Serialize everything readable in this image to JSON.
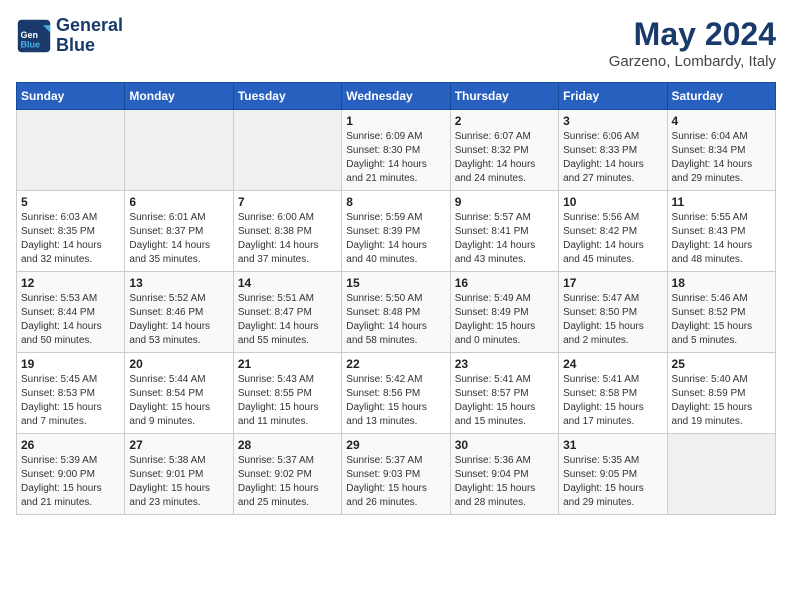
{
  "logo": {
    "line1": "General",
    "line2": "Blue"
  },
  "title": "May 2024",
  "subtitle": "Garzeno, Lombardy, Italy",
  "days_of_week": [
    "Sunday",
    "Monday",
    "Tuesday",
    "Wednesday",
    "Thursday",
    "Friday",
    "Saturday"
  ],
  "weeks": [
    [
      {
        "day": "",
        "info": ""
      },
      {
        "day": "",
        "info": ""
      },
      {
        "day": "",
        "info": ""
      },
      {
        "day": "1",
        "info": "Sunrise: 6:09 AM\nSunset: 8:30 PM\nDaylight: 14 hours\nand 21 minutes."
      },
      {
        "day": "2",
        "info": "Sunrise: 6:07 AM\nSunset: 8:32 PM\nDaylight: 14 hours\nand 24 minutes."
      },
      {
        "day": "3",
        "info": "Sunrise: 6:06 AM\nSunset: 8:33 PM\nDaylight: 14 hours\nand 27 minutes."
      },
      {
        "day": "4",
        "info": "Sunrise: 6:04 AM\nSunset: 8:34 PM\nDaylight: 14 hours\nand 29 minutes."
      }
    ],
    [
      {
        "day": "5",
        "info": "Sunrise: 6:03 AM\nSunset: 8:35 PM\nDaylight: 14 hours\nand 32 minutes."
      },
      {
        "day": "6",
        "info": "Sunrise: 6:01 AM\nSunset: 8:37 PM\nDaylight: 14 hours\nand 35 minutes."
      },
      {
        "day": "7",
        "info": "Sunrise: 6:00 AM\nSunset: 8:38 PM\nDaylight: 14 hours\nand 37 minutes."
      },
      {
        "day": "8",
        "info": "Sunrise: 5:59 AM\nSunset: 8:39 PM\nDaylight: 14 hours\nand 40 minutes."
      },
      {
        "day": "9",
        "info": "Sunrise: 5:57 AM\nSunset: 8:41 PM\nDaylight: 14 hours\nand 43 minutes."
      },
      {
        "day": "10",
        "info": "Sunrise: 5:56 AM\nSunset: 8:42 PM\nDaylight: 14 hours\nand 45 minutes."
      },
      {
        "day": "11",
        "info": "Sunrise: 5:55 AM\nSunset: 8:43 PM\nDaylight: 14 hours\nand 48 minutes."
      }
    ],
    [
      {
        "day": "12",
        "info": "Sunrise: 5:53 AM\nSunset: 8:44 PM\nDaylight: 14 hours\nand 50 minutes."
      },
      {
        "day": "13",
        "info": "Sunrise: 5:52 AM\nSunset: 8:46 PM\nDaylight: 14 hours\nand 53 minutes."
      },
      {
        "day": "14",
        "info": "Sunrise: 5:51 AM\nSunset: 8:47 PM\nDaylight: 14 hours\nand 55 minutes."
      },
      {
        "day": "15",
        "info": "Sunrise: 5:50 AM\nSunset: 8:48 PM\nDaylight: 14 hours\nand 58 minutes."
      },
      {
        "day": "16",
        "info": "Sunrise: 5:49 AM\nSunset: 8:49 PM\nDaylight: 15 hours\nand 0 minutes."
      },
      {
        "day": "17",
        "info": "Sunrise: 5:47 AM\nSunset: 8:50 PM\nDaylight: 15 hours\nand 2 minutes."
      },
      {
        "day": "18",
        "info": "Sunrise: 5:46 AM\nSunset: 8:52 PM\nDaylight: 15 hours\nand 5 minutes."
      }
    ],
    [
      {
        "day": "19",
        "info": "Sunrise: 5:45 AM\nSunset: 8:53 PM\nDaylight: 15 hours\nand 7 minutes."
      },
      {
        "day": "20",
        "info": "Sunrise: 5:44 AM\nSunset: 8:54 PM\nDaylight: 15 hours\nand 9 minutes."
      },
      {
        "day": "21",
        "info": "Sunrise: 5:43 AM\nSunset: 8:55 PM\nDaylight: 15 hours\nand 11 minutes."
      },
      {
        "day": "22",
        "info": "Sunrise: 5:42 AM\nSunset: 8:56 PM\nDaylight: 15 hours\nand 13 minutes."
      },
      {
        "day": "23",
        "info": "Sunrise: 5:41 AM\nSunset: 8:57 PM\nDaylight: 15 hours\nand 15 minutes."
      },
      {
        "day": "24",
        "info": "Sunrise: 5:41 AM\nSunset: 8:58 PM\nDaylight: 15 hours\nand 17 minutes."
      },
      {
        "day": "25",
        "info": "Sunrise: 5:40 AM\nSunset: 8:59 PM\nDaylight: 15 hours\nand 19 minutes."
      }
    ],
    [
      {
        "day": "26",
        "info": "Sunrise: 5:39 AM\nSunset: 9:00 PM\nDaylight: 15 hours\nand 21 minutes."
      },
      {
        "day": "27",
        "info": "Sunrise: 5:38 AM\nSunset: 9:01 PM\nDaylight: 15 hours\nand 23 minutes."
      },
      {
        "day": "28",
        "info": "Sunrise: 5:37 AM\nSunset: 9:02 PM\nDaylight: 15 hours\nand 25 minutes."
      },
      {
        "day": "29",
        "info": "Sunrise: 5:37 AM\nSunset: 9:03 PM\nDaylight: 15 hours\nand 26 minutes."
      },
      {
        "day": "30",
        "info": "Sunrise: 5:36 AM\nSunset: 9:04 PM\nDaylight: 15 hours\nand 28 minutes."
      },
      {
        "day": "31",
        "info": "Sunrise: 5:35 AM\nSunset: 9:05 PM\nDaylight: 15 hours\nand 29 minutes."
      },
      {
        "day": "",
        "info": ""
      }
    ]
  ]
}
